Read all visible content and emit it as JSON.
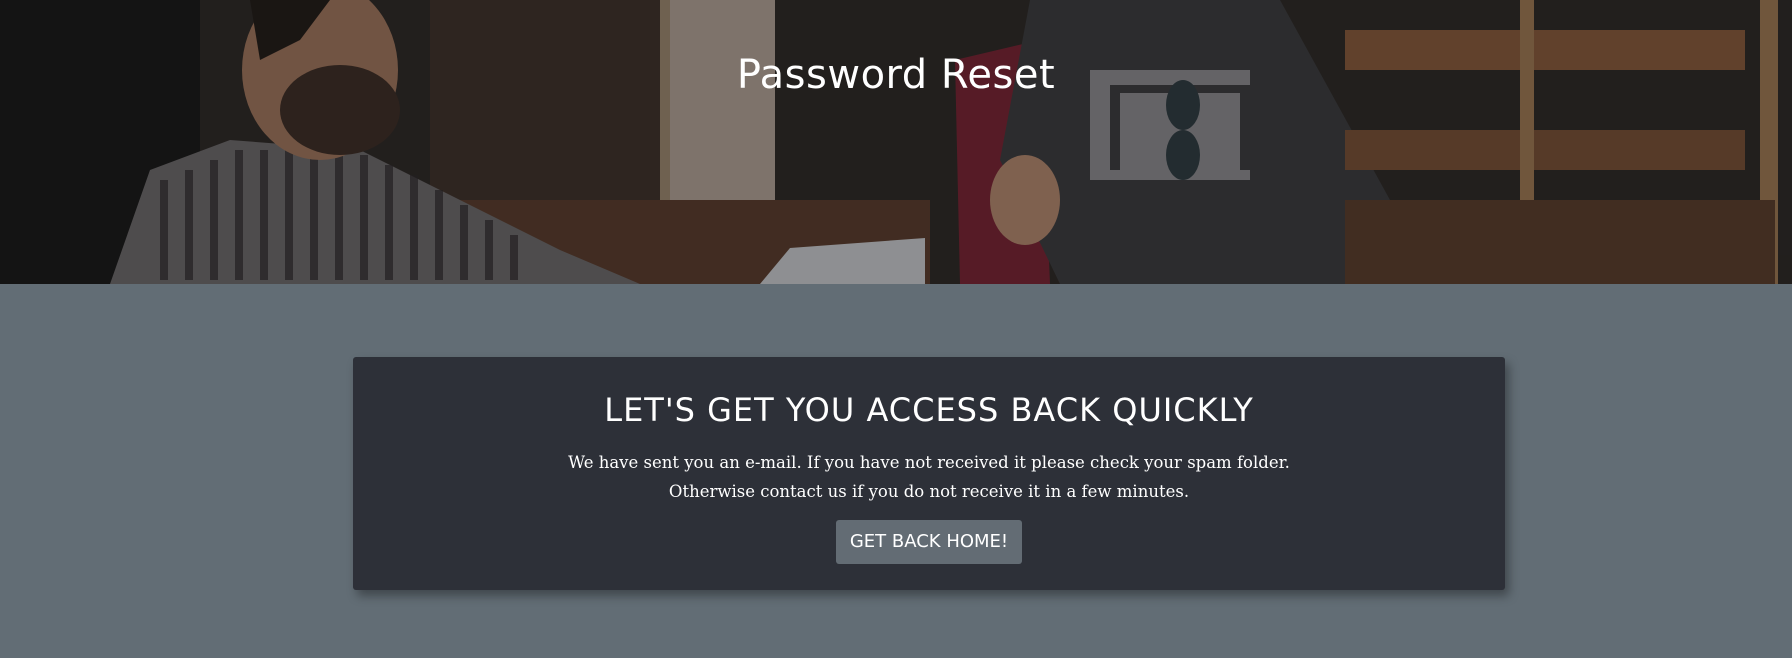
{
  "hero": {
    "title": "Password Reset"
  },
  "card": {
    "heading": "LET'S GET YOU ACCESS BACK QUICKLY",
    "message": "We have sent you an e-mail. If you have not received it please check your spam folder. Otherwise contact us if you do not receive it in a few minutes.",
    "button_label": "GET BACK HOME!"
  },
  "colors": {
    "page_background": "#626d75",
    "card_background": "#2d3038",
    "button_background": "#636c74",
    "text": "#ffffff"
  }
}
